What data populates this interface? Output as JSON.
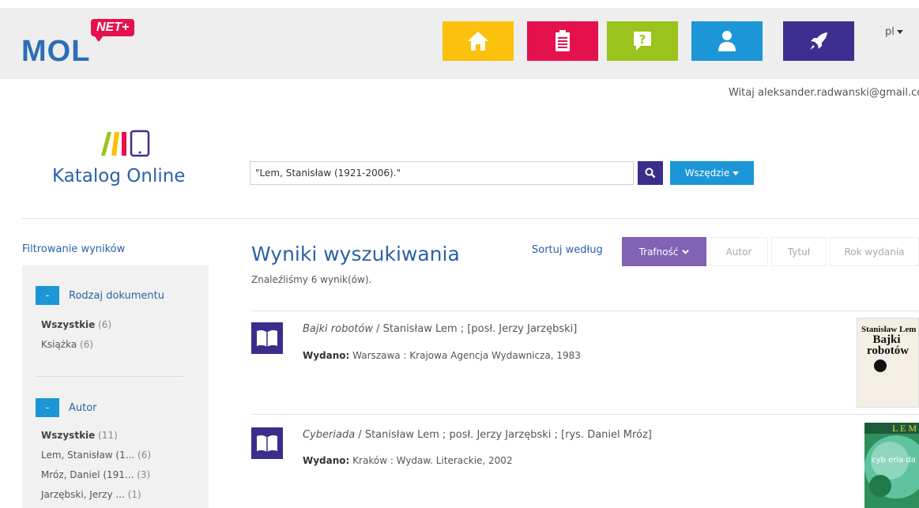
{
  "header": {
    "logo_text": "MOL",
    "logo_badge": "NET+",
    "nav": [
      {
        "name": "home",
        "color": "#fbc10d",
        "icon": "home-icon"
      },
      {
        "name": "clipboard",
        "color": "#e5114e",
        "icon": "clipboard-icon"
      },
      {
        "name": "help",
        "color": "#9ac31c",
        "icon": "question-icon"
      },
      {
        "name": "account",
        "color": "#1c96d6",
        "icon": "user-icon"
      },
      {
        "name": "launch",
        "color": "#3d2f8f",
        "icon": "rocket-icon"
      }
    ],
    "language": "pl",
    "welcome": "Witaj aleksander.radwanski@gmail.com"
  },
  "catalog": {
    "title": "Katalog Online",
    "logo_colors": [
      "#9ac31c",
      "#fbc10d",
      "#e5114e",
      "#3d2f8f"
    ]
  },
  "search": {
    "value": "\"Lem, Stanisław (1921-2006).\"",
    "scope_label": "Wszędzie"
  },
  "sidebar": {
    "title": "Filtrowanie wyników",
    "facets": [
      {
        "toggle": "-",
        "label": "Rodzaj dokumentu",
        "items": [
          {
            "label": "Wszystkie",
            "count": "(6)"
          },
          {
            "label": "Książka",
            "count": "(6)"
          }
        ]
      },
      {
        "toggle": "-",
        "label": "Autor",
        "items": [
          {
            "label": "Wszystkie",
            "count": "(11)"
          },
          {
            "label": "Lem, Stanisław (1...",
            "count": "(6)"
          },
          {
            "label": "Mróz, Daniel (191...",
            "count": "(3)"
          },
          {
            "label": "Jarzębski, Jerzy ...",
            "count": "(1)"
          }
        ]
      }
    ]
  },
  "results": {
    "title": "Wyniki wyszukiwania",
    "count_text": "Znaleźliśmy 6 wynik(ów).",
    "sort_label": "Sortuj według",
    "sort_options": [
      "Trafność",
      "Autor",
      "Tytuł",
      "Rok wydania"
    ],
    "published_label": "Wydano:",
    "items": [
      {
        "title": "Bajki robotów",
        "rest": " / Stanisław Lem ; [posł. Jerzy Jarzębski]",
        "published": "Warszawa : Krajowa Agencja Wydawnicza, 1983",
        "cover_author": "Stanisław Lem",
        "cover_title": "Bajki robotów"
      },
      {
        "title": "Cyberiada",
        "rest": " / Stanisław Lem ; posł. Jerzy Jarzębski ; [rys. Daniel Mróz]",
        "published": "Kraków : Wydaw. Literackie, 2002",
        "cover_author": "L E M",
        "cover_title": "cyb erla da"
      }
    ]
  }
}
